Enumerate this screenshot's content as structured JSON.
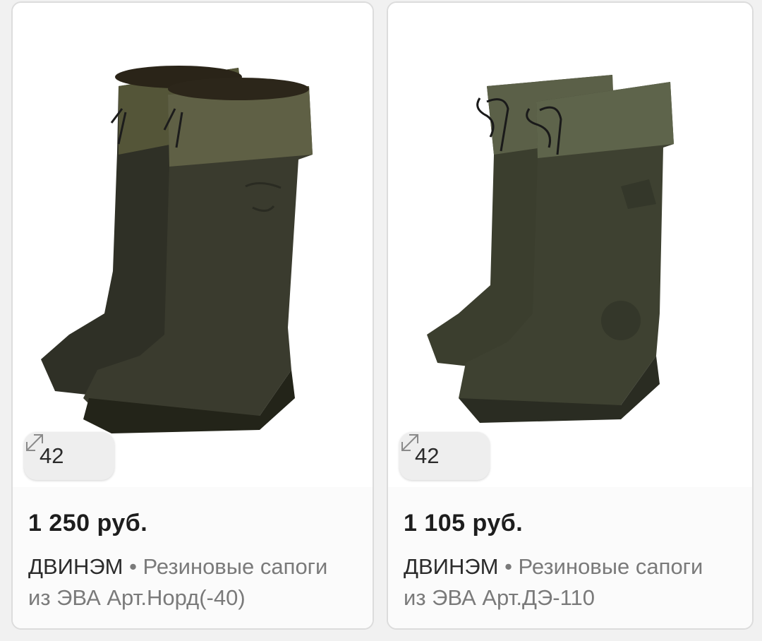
{
  "products": [
    {
      "size": "42",
      "price": "1 250 руб.",
      "brand": "ДВИНЭМ",
      "separator": " • ",
      "title": "Резиновые сапоги из ЭВА Арт.Норд(-40)",
      "image_label": "rubber-boots-nord"
    },
    {
      "size": "42",
      "price": "1 105 руб.",
      "brand": "ДВИНЭМ",
      "separator": " • ",
      "title": "Резиновые сапоги из ЭВА Арт.ДЭ-110",
      "image_label": "rubber-boots-de110"
    }
  ],
  "colors": {
    "boot_body": "#3c3d30",
    "boot_cuff": "#5d5f45",
    "price_text": "#1d1d1d",
    "desc_text": "#7a7a7a"
  }
}
